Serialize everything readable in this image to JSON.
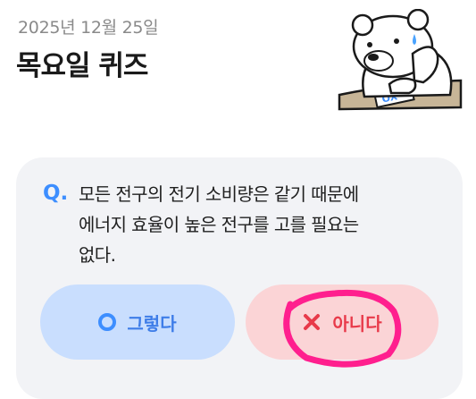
{
  "header": {
    "date": "2025년 12월 25일",
    "title": "목요일 퀴즈"
  },
  "mascot": {
    "name": "polar-bear-icon",
    "card_text": "OX"
  },
  "quiz": {
    "q_label": "Q.",
    "question": "모든 전구의 전기 소비량은 같기 때문에 에너지 효율이 높은 전구를 고를 필요는 없다.",
    "options": [
      {
        "label": "그렇다",
        "icon": "circle-o-icon",
        "color": "#3d8eff"
      },
      {
        "label": "아니다",
        "icon": "x-icon",
        "color": "#e83a4a"
      }
    ]
  },
  "annotation": {
    "color": "#ff1f8e"
  }
}
